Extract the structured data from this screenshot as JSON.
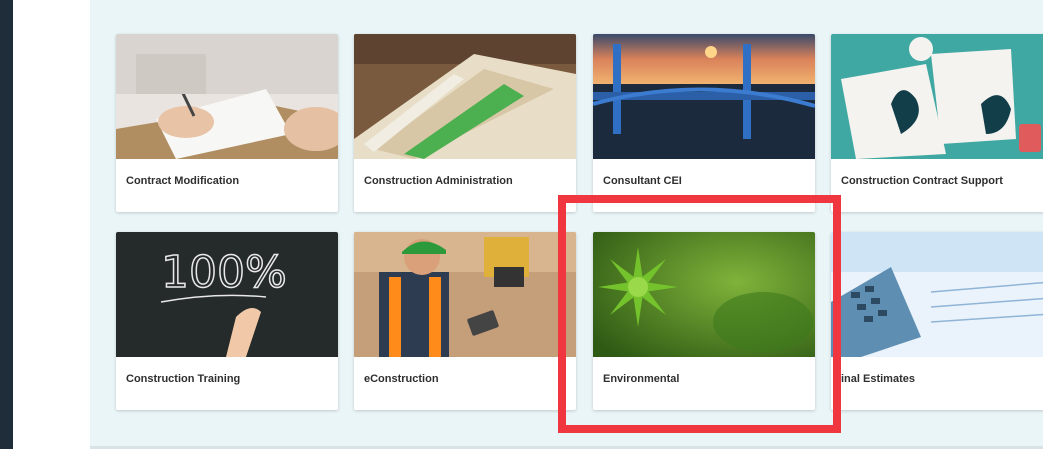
{
  "tiles": [
    {
      "label": "Contract Modification",
      "image": "hand-signing-document-photo"
    },
    {
      "label": "Construction Administration",
      "image": "file-folders-photo"
    },
    {
      "label": "Consultant CEI",
      "image": "bridge-sunset-photo"
    },
    {
      "label": "Construction Contract Support",
      "image": "contract-signing-illustration"
    },
    {
      "label": "Construction Training",
      "image": "chalkboard-100-percent-photo"
    },
    {
      "label": "eConstruction",
      "image": "worker-with-tablet-photo"
    },
    {
      "label": "Environmental",
      "image": "green-plant-photo"
    },
    {
      "label": "inal Estimates",
      "image": "calculator-photo"
    }
  ],
  "chalkboard_text": "100%",
  "colors": {
    "page_background": "#eaf5f7",
    "card_background": "#ffffff",
    "highlight_border": "#f0363e",
    "left_bar": "#1f2d3a"
  }
}
